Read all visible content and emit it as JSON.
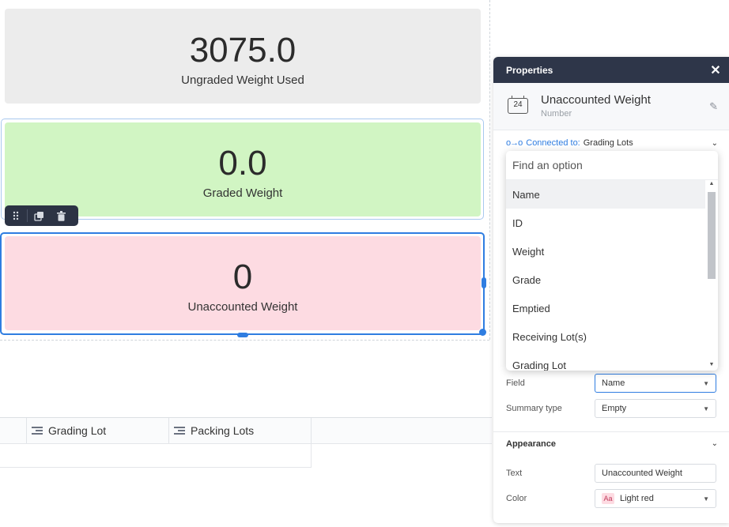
{
  "cards": [
    {
      "value": "3075.0",
      "label": "Ungraded Weight Used",
      "color": "#ececec"
    },
    {
      "value": "0.0",
      "label": "Graded Weight",
      "color": "#d1f5c3"
    },
    {
      "value": "0",
      "label": "Unaccounted Weight",
      "color": "#fddbe2"
    }
  ],
  "table": {
    "columns": [
      "Grading Lot",
      "Packing Lots"
    ]
  },
  "panel": {
    "title": "Properties",
    "element_name": "Unaccounted Weight",
    "element_type": "Number",
    "number_icon": "24",
    "connected_label": "Connected to:",
    "connected_value": "Grading Lots",
    "field_label": "Field",
    "field_value": "Name",
    "summary_label": "Summary type",
    "summary_value": "Empty",
    "appearance_label": "Appearance",
    "text_label": "Text",
    "text_value": "Unaccounted Weight",
    "color_label": "Color",
    "color_swatch": "Aa",
    "color_value": "Light red"
  },
  "dropdown": {
    "placeholder": "Find an option",
    "options": [
      "Name",
      "ID",
      "Weight",
      "Grade",
      "Emptied",
      "Receiving Lot(s)",
      "Grading Lot"
    ]
  },
  "accent": "#2f7de1"
}
